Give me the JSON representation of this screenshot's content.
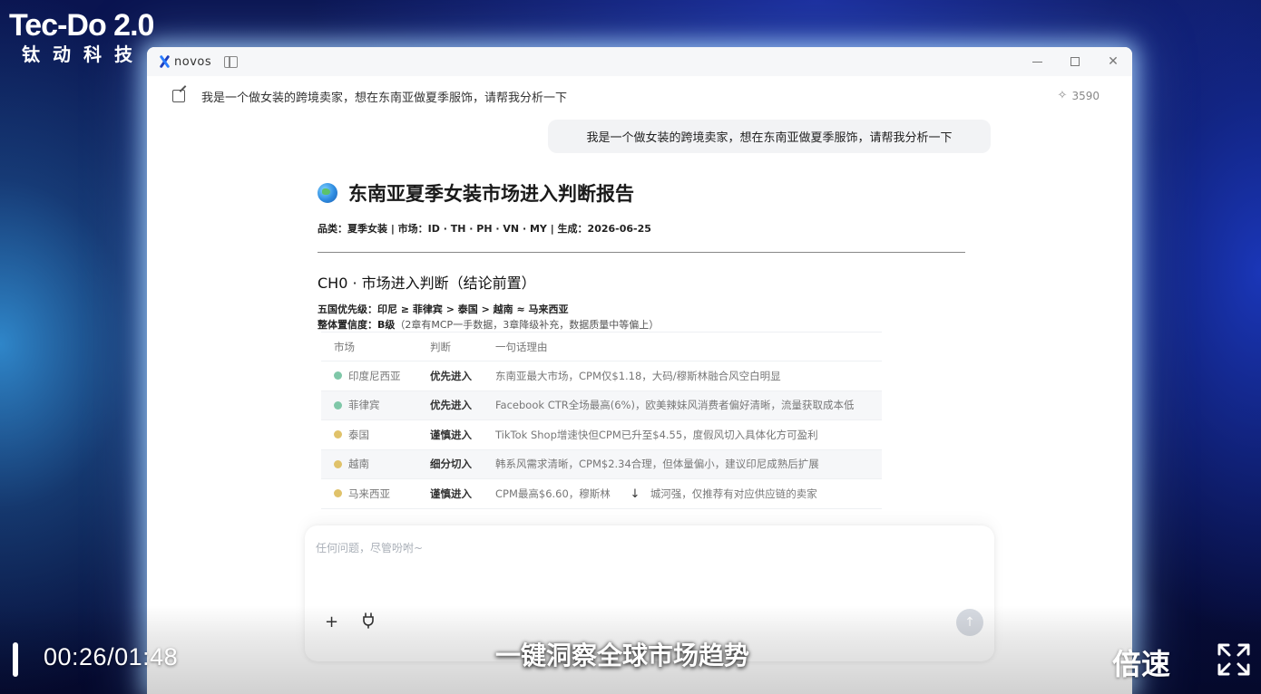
{
  "brand": {
    "title": "Tec-Do 2.0",
    "subtitle": "钛动科技"
  },
  "app": {
    "name": "novos"
  },
  "conversation": {
    "title": "我是一个做女装的跨境卖家，想在东南亚做夏季服饰，请帮我分析一下",
    "credits": "3590",
    "user_message": "我是一个做女装的跨境卖家，想在东南亚做夏季服饰，请帮我分析一下"
  },
  "report": {
    "title": "东南亚夏季女装市场进入判断报告",
    "meta": "品类：夏季女装 | 市场：ID · TH · PH · VN · MY | 生成：2026-06-25",
    "chapter_title": "CH0 · 市场进入判断（结论前置）",
    "priority_label": "五国优先级：",
    "priority_value": "印尼 ≥ 菲律宾 > 泰国 > 越南 ≈ 马来西亚",
    "confidence_label": "整体置信度：",
    "confidence_value": "B级",
    "confidence_note": "（2章有MCP一手数据，3章降级补充，数据质量中等偏上）",
    "table": {
      "headers": [
        "市场",
        "判断",
        "一句话理由"
      ],
      "rows": [
        {
          "market": "印度尼西亚",
          "verdict": "优先进入",
          "reason": "东南亚最大市场，CPM仅$1.18，大码/穆斯林融合风空白明显",
          "dot_color": "#7fc7a8"
        },
        {
          "market": "菲律宾",
          "verdict": "优先进入",
          "reason": "Facebook CTR全场最高(6%)，欧美辣妹风消费者偏好清晰，流量获取成本低",
          "dot_color": "#7fc7a8"
        },
        {
          "market": "泰国",
          "verdict": "谨慎进入",
          "reason": "TikTok Shop增速快但CPM已升至$4.55，度假风切入具体化方可盈利",
          "dot_color": "#e0c26a"
        },
        {
          "market": "越南",
          "verdict": "细分切入",
          "reason": "韩系风需求清晰，CPM$2.34合理，但体量偏小，建议印尼成熟后扩展",
          "dot_color": "#e0c26a"
        },
        {
          "market": "马来西亚",
          "verdict": "谨慎进入",
          "reason": "CPM最高$6.60，穆斯林",
          "reason_tail": "城河强，仅推荐有对应供应链的卖家",
          "dot_color": "#e0c26a"
        }
      ]
    }
  },
  "composer": {
    "placeholder": "任何问题，尽管吩咐~",
    "value": ""
  },
  "video": {
    "timecode": "00:26/01:48",
    "subtitle": "一键洞察全球市场趋势",
    "speed_label": "倍速"
  }
}
